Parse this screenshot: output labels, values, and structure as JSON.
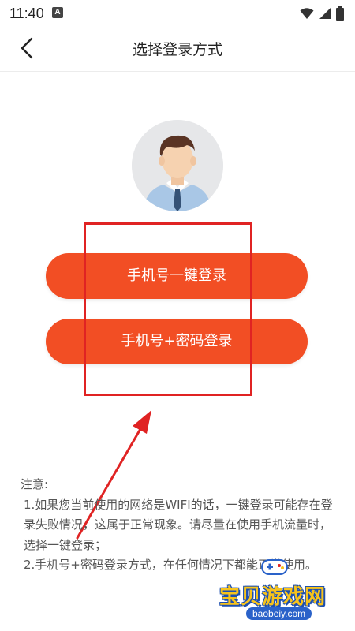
{
  "status_bar": {
    "time": "11:40",
    "notification_icon": "A"
  },
  "header": {
    "title": "选择登录方式"
  },
  "login_options": {
    "onekey_label": "手机号一键登录",
    "password_label": "手机号+密码登录"
  },
  "notes": {
    "heading": "注意:",
    "line1": " 1.如果您当前使用的网络是WIFI的话，一键登录可能存在登录失败情况，这属于正常现象。请尽量在使用手机流量时，选择一键登录；",
    "line2": " 2.手机号+密码登录方式，在任何情况下都能正常使用。"
  },
  "watermark": {
    "title": "宝贝游戏网",
    "url": "baobeiy.com"
  },
  "colors": {
    "accent": "#f24e24",
    "highlight": "#e02323"
  }
}
